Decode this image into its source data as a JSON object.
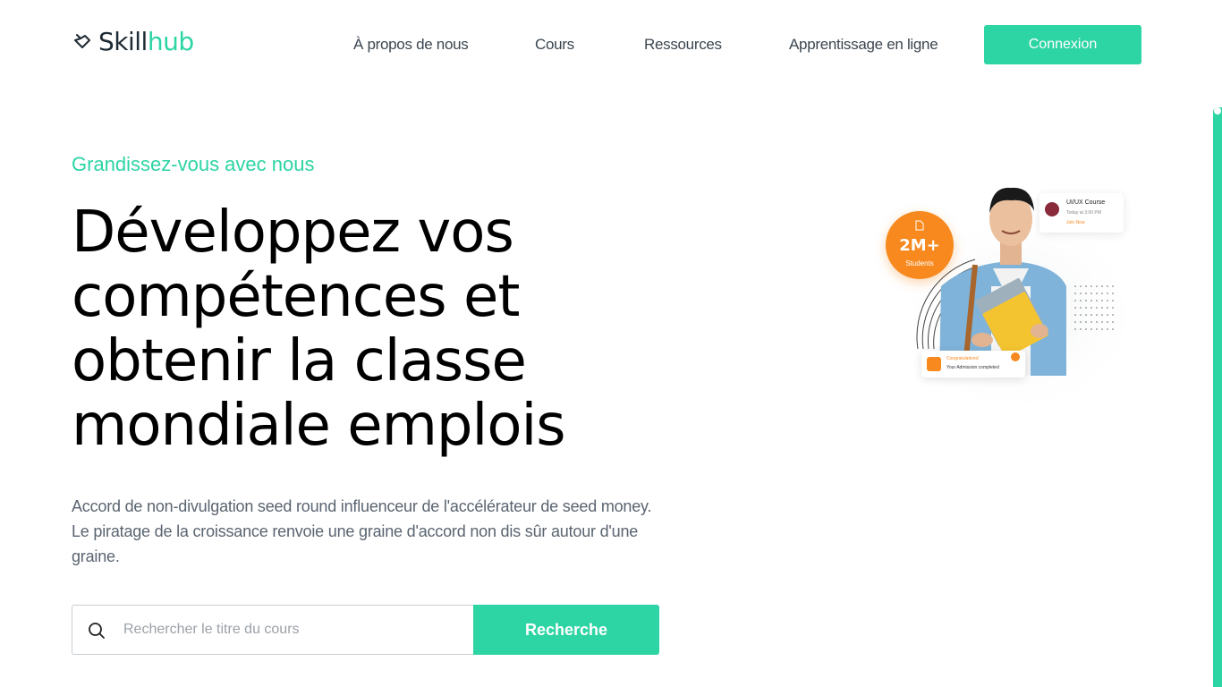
{
  "brand": {
    "name_part1": "Skill",
    "name_part2": "hub"
  },
  "nav": {
    "items": [
      {
        "label": "À propos de nous"
      },
      {
        "label": "Cours"
      },
      {
        "label": "Ressources"
      },
      {
        "label": "Apprentissage en ligne"
      }
    ],
    "login_label": "Connexion"
  },
  "hero": {
    "eyebrow": "Grandissez-vous avec nous",
    "headline_lines": [
      "Développez vos",
      "compétences et",
      "obtenir la classe",
      "mondiale emplois"
    ],
    "lead": "Accord de non-divulgation seed round influenceur de l'accélérateur de seed money. Le piratage de la croissance renvoie une graine d'accord non dis sûr autour d'une graine.",
    "search": {
      "placeholder": "Rechercher le titre du cours",
      "value": "",
      "button_label": "Recherche"
    }
  },
  "illustration": {
    "badge": {
      "value": "2M+",
      "label": "Students"
    },
    "course_card": {
      "title": "UI/UX Course",
      "time": "Today at 3:00 PM",
      "link": "Join Now"
    },
    "congrats_card": {
      "title": "Congratulations!",
      "text": "Your Admission completed"
    }
  },
  "colors": {
    "accent": "#2dd4a4",
    "orange": "#f7891e",
    "text_dark": "#000000",
    "text_muted": "#5a6470"
  }
}
